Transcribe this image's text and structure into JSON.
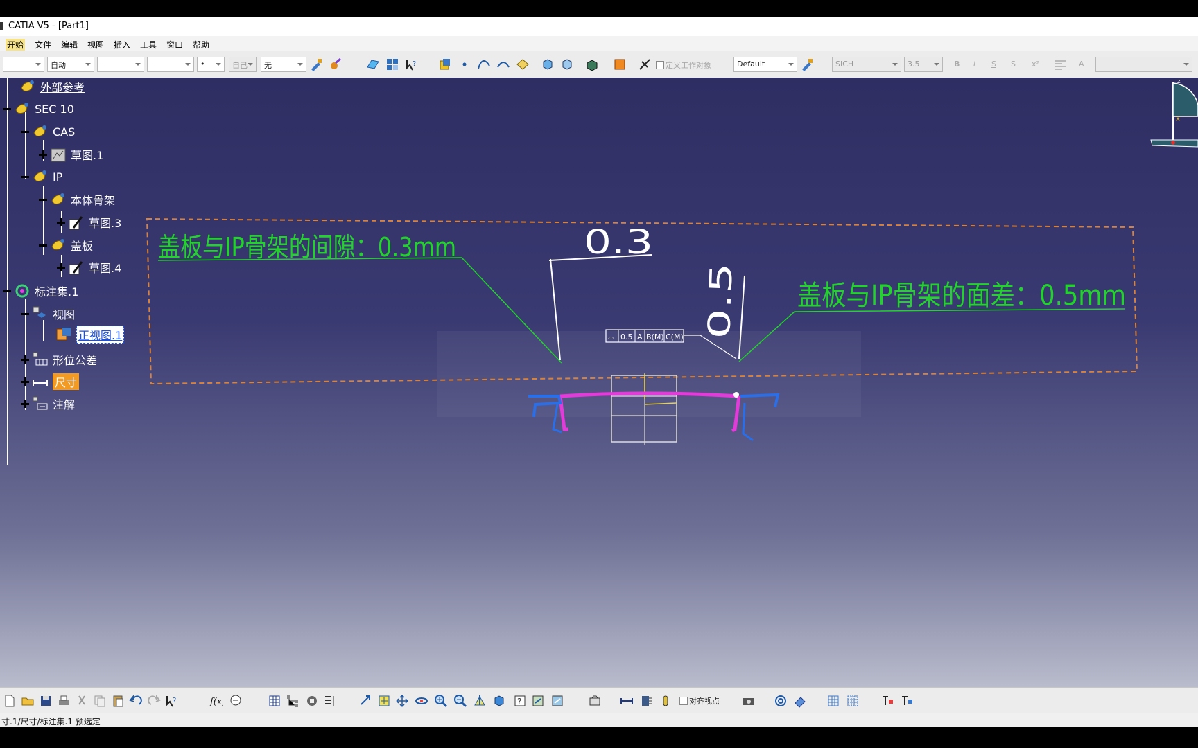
{
  "window": {
    "title": "CATIA V5 - [Part1]"
  },
  "menu": [
    {
      "label": "开始",
      "active": true
    },
    {
      "label": "文件"
    },
    {
      "label": "编辑"
    },
    {
      "label": "视图"
    },
    {
      "label": "插入"
    },
    {
      "label": "工具"
    },
    {
      "label": "窗口"
    },
    {
      "label": "帮助"
    }
  ],
  "toolbar": {
    "combo_auto": "自动",
    "combo_dot": "•",
    "combo_self": "自己",
    "combo_none": "无",
    "define_work_object": "定义工作对象",
    "style": "Default",
    "font": "SICH",
    "font_size": "3.5",
    "bold": "B",
    "italic": "I",
    "strike": "S",
    "font_strike2": "S",
    "superscript": "x²",
    "text_a": "A"
  },
  "tree": [
    {
      "label": "外部参考",
      "expander": "none"
    },
    {
      "label": "SEC 10",
      "expander": "minus"
    },
    {
      "label": "CAS",
      "expander": "minus"
    },
    {
      "label": "草图.1",
      "expander": "plus"
    },
    {
      "label": "IP",
      "expander": "minus"
    },
    {
      "label": "本体骨架",
      "expander": "minus"
    },
    {
      "label": "草图.3",
      "expander": "plus"
    },
    {
      "label": "盖板",
      "expander": "minus"
    },
    {
      "label": "草图.4",
      "expander": "plus"
    },
    {
      "label": "标注集.1",
      "expander": "minus"
    },
    {
      "label": "视图",
      "expander": "minus"
    },
    {
      "label": "正视图.1",
      "expander": "none",
      "selected": true
    },
    {
      "label": "形位公差",
      "expander": "plus"
    },
    {
      "label": "尺寸",
      "expander": "plus",
      "highlighted": true
    },
    {
      "label": "注解",
      "expander": "plus"
    }
  ],
  "annotations": {
    "gap_note": "盖板与IP骨架的间隙：0.3mm",
    "flush_note": "盖板与IP骨架的面差：0.5mm",
    "dim_gap": "0.3",
    "dim_flush": "0.5",
    "gdt_frame": [
      "⌓",
      "0.5",
      "A",
      "B(M)",
      "C(M)"
    ]
  },
  "compass": {
    "axis_z": "z",
    "axis_x": "x"
  },
  "bottom_toolbar": {
    "align_viewpoint": "对齐视点"
  },
  "status": "寸.1/尺寸/标注集.1 预选定",
  "colors": {
    "viewport_top": "#2e2e63",
    "annotation_green": "#22d32b",
    "cover_magenta": "#e23bd9",
    "frame_orange": "#d9823a",
    "ip_blue": "#2a6fe8",
    "highlight_orange": "#f29a22"
  }
}
